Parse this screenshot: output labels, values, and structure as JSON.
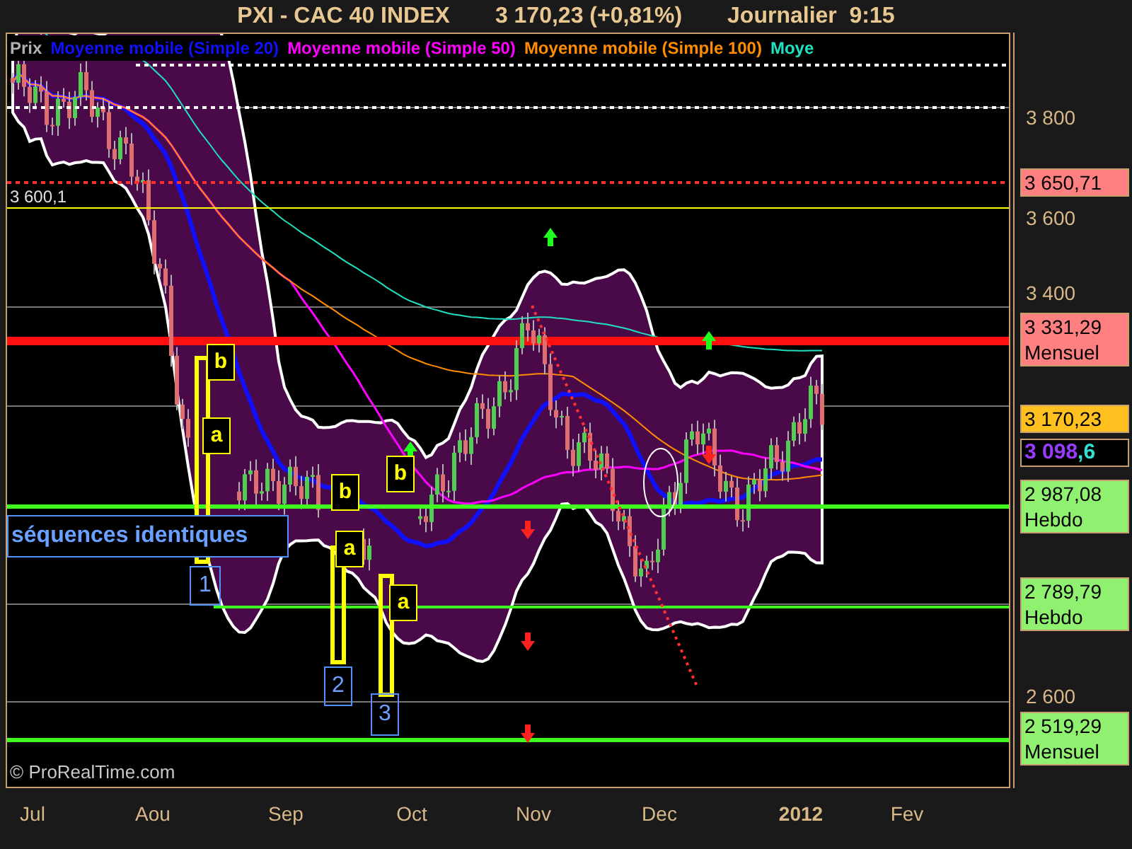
{
  "header": {
    "instrument": "PXI - CAC 40 INDEX",
    "quote": "3 170,23 (+0,81%)",
    "period": "Journalier  9:15"
  },
  "legend": [
    {
      "label": "Prix"
    },
    {
      "label": "Moyenne mobile (Simple 20)",
      "color": "#1010ff"
    },
    {
      "label": "Moyenne mobile (Simple 50)",
      "color": "#ff00ff"
    },
    {
      "label": "Moyenne mobile (Simple 100)",
      "color": "#ff8c00"
    },
    {
      "label": "Moye",
      "color": "#20e0c0"
    }
  ],
  "chart": {
    "left_label": "3 600,1",
    "annotation": "séquences identiques",
    "sequence_numbers": [
      "1",
      "2",
      "3"
    ],
    "markers": [
      "b",
      "a",
      "b",
      "b",
      "a",
      "a"
    ],
    "copyright": "© ProRealTime.com"
  },
  "price_axis": [
    {
      "kind": "tick",
      "label": "3 800"
    },
    {
      "kind": "tag",
      "label": "3 650,71",
      "color": "#ff8080"
    },
    {
      "kind": "tick",
      "label": "3 600"
    },
    {
      "kind": "tick",
      "label": "3 400"
    },
    {
      "kind": "tag",
      "label": "3 331,29",
      "note": "Mensuel",
      "color": "#ff8080"
    },
    {
      "kind": "tag",
      "label": "3 170,23",
      "color": "#ffc020"
    },
    {
      "kind": "split",
      "parts": [
        {
          "label": "3 098"
        },
        {
          "label": ",6"
        }
      ]
    },
    {
      "kind": "tag",
      "label": "2 987,08",
      "note": "Hebdo",
      "color": "#90f070"
    },
    {
      "kind": "tag",
      "label": "2 789,79",
      "note": "Hebdo",
      "color": "#90f070"
    },
    {
      "kind": "tick",
      "label": "2 600"
    },
    {
      "kind": "tag",
      "label": "2 519,29",
      "note": "Mensuel",
      "color": "#90f070"
    }
  ],
  "time_axis": [
    {
      "label": "Jul",
      "bold": false
    },
    {
      "label": "Aou",
      "bold": false
    },
    {
      "label": "Sep",
      "bold": false
    },
    {
      "label": "Oct",
      "bold": false
    },
    {
      "label": "Nov",
      "bold": false
    },
    {
      "label": "Dec",
      "bold": false
    },
    {
      "label": "2012",
      "bold": true
    },
    {
      "label": "Fev",
      "bold": false
    }
  ]
}
